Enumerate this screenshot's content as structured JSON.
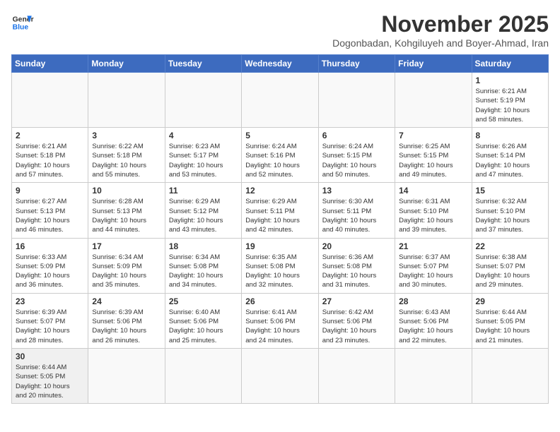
{
  "header": {
    "logo": {
      "text_general": "General",
      "text_blue": "Blue"
    },
    "title": "November 2025",
    "subtitle": "Dogonbadan, Kohgiluyeh and Boyer-Ahmad, Iran"
  },
  "days_of_week": [
    "Sunday",
    "Monday",
    "Tuesday",
    "Wednesday",
    "Thursday",
    "Friday",
    "Saturday"
  ],
  "weeks": [
    [
      {
        "day": "",
        "info": ""
      },
      {
        "day": "",
        "info": ""
      },
      {
        "day": "",
        "info": ""
      },
      {
        "day": "",
        "info": ""
      },
      {
        "day": "",
        "info": ""
      },
      {
        "day": "",
        "info": ""
      },
      {
        "day": "1",
        "info": "Sunrise: 6:21 AM\nSunset: 5:19 PM\nDaylight: 10 hours\nand 58 minutes."
      }
    ],
    [
      {
        "day": "2",
        "info": "Sunrise: 6:21 AM\nSunset: 5:18 PM\nDaylight: 10 hours\nand 57 minutes."
      },
      {
        "day": "3",
        "info": "Sunrise: 6:22 AM\nSunset: 5:18 PM\nDaylight: 10 hours\nand 55 minutes."
      },
      {
        "day": "4",
        "info": "Sunrise: 6:23 AM\nSunset: 5:17 PM\nDaylight: 10 hours\nand 53 minutes."
      },
      {
        "day": "5",
        "info": "Sunrise: 6:24 AM\nSunset: 5:16 PM\nDaylight: 10 hours\nand 52 minutes."
      },
      {
        "day": "6",
        "info": "Sunrise: 6:24 AM\nSunset: 5:15 PM\nDaylight: 10 hours\nand 50 minutes."
      },
      {
        "day": "7",
        "info": "Sunrise: 6:25 AM\nSunset: 5:15 PM\nDaylight: 10 hours\nand 49 minutes."
      },
      {
        "day": "8",
        "info": "Sunrise: 6:26 AM\nSunset: 5:14 PM\nDaylight: 10 hours\nand 47 minutes."
      }
    ],
    [
      {
        "day": "9",
        "info": "Sunrise: 6:27 AM\nSunset: 5:13 PM\nDaylight: 10 hours\nand 46 minutes."
      },
      {
        "day": "10",
        "info": "Sunrise: 6:28 AM\nSunset: 5:13 PM\nDaylight: 10 hours\nand 44 minutes."
      },
      {
        "day": "11",
        "info": "Sunrise: 6:29 AM\nSunset: 5:12 PM\nDaylight: 10 hours\nand 43 minutes."
      },
      {
        "day": "12",
        "info": "Sunrise: 6:29 AM\nSunset: 5:11 PM\nDaylight: 10 hours\nand 42 minutes."
      },
      {
        "day": "13",
        "info": "Sunrise: 6:30 AM\nSunset: 5:11 PM\nDaylight: 10 hours\nand 40 minutes."
      },
      {
        "day": "14",
        "info": "Sunrise: 6:31 AM\nSunset: 5:10 PM\nDaylight: 10 hours\nand 39 minutes."
      },
      {
        "day": "15",
        "info": "Sunrise: 6:32 AM\nSunset: 5:10 PM\nDaylight: 10 hours\nand 37 minutes."
      }
    ],
    [
      {
        "day": "16",
        "info": "Sunrise: 6:33 AM\nSunset: 5:09 PM\nDaylight: 10 hours\nand 36 minutes."
      },
      {
        "day": "17",
        "info": "Sunrise: 6:34 AM\nSunset: 5:09 PM\nDaylight: 10 hours\nand 35 minutes."
      },
      {
        "day": "18",
        "info": "Sunrise: 6:34 AM\nSunset: 5:08 PM\nDaylight: 10 hours\nand 34 minutes."
      },
      {
        "day": "19",
        "info": "Sunrise: 6:35 AM\nSunset: 5:08 PM\nDaylight: 10 hours\nand 32 minutes."
      },
      {
        "day": "20",
        "info": "Sunrise: 6:36 AM\nSunset: 5:08 PM\nDaylight: 10 hours\nand 31 minutes."
      },
      {
        "day": "21",
        "info": "Sunrise: 6:37 AM\nSunset: 5:07 PM\nDaylight: 10 hours\nand 30 minutes."
      },
      {
        "day": "22",
        "info": "Sunrise: 6:38 AM\nSunset: 5:07 PM\nDaylight: 10 hours\nand 29 minutes."
      }
    ],
    [
      {
        "day": "23",
        "info": "Sunrise: 6:39 AM\nSunset: 5:07 PM\nDaylight: 10 hours\nand 28 minutes."
      },
      {
        "day": "24",
        "info": "Sunrise: 6:39 AM\nSunset: 5:06 PM\nDaylight: 10 hours\nand 26 minutes."
      },
      {
        "day": "25",
        "info": "Sunrise: 6:40 AM\nSunset: 5:06 PM\nDaylight: 10 hours\nand 25 minutes."
      },
      {
        "day": "26",
        "info": "Sunrise: 6:41 AM\nSunset: 5:06 PM\nDaylight: 10 hours\nand 24 minutes."
      },
      {
        "day": "27",
        "info": "Sunrise: 6:42 AM\nSunset: 5:06 PM\nDaylight: 10 hours\nand 23 minutes."
      },
      {
        "day": "28",
        "info": "Sunrise: 6:43 AM\nSunset: 5:06 PM\nDaylight: 10 hours\nand 22 minutes."
      },
      {
        "day": "29",
        "info": "Sunrise: 6:44 AM\nSunset: 5:05 PM\nDaylight: 10 hours\nand 21 minutes."
      }
    ],
    [
      {
        "day": "30",
        "info": "Sunrise: 6:44 AM\nSunset: 5:05 PM\nDaylight: 10 hours\nand 20 minutes."
      },
      {
        "day": "",
        "info": ""
      },
      {
        "day": "",
        "info": ""
      },
      {
        "day": "",
        "info": ""
      },
      {
        "day": "",
        "info": ""
      },
      {
        "day": "",
        "info": ""
      },
      {
        "day": "",
        "info": ""
      }
    ]
  ]
}
